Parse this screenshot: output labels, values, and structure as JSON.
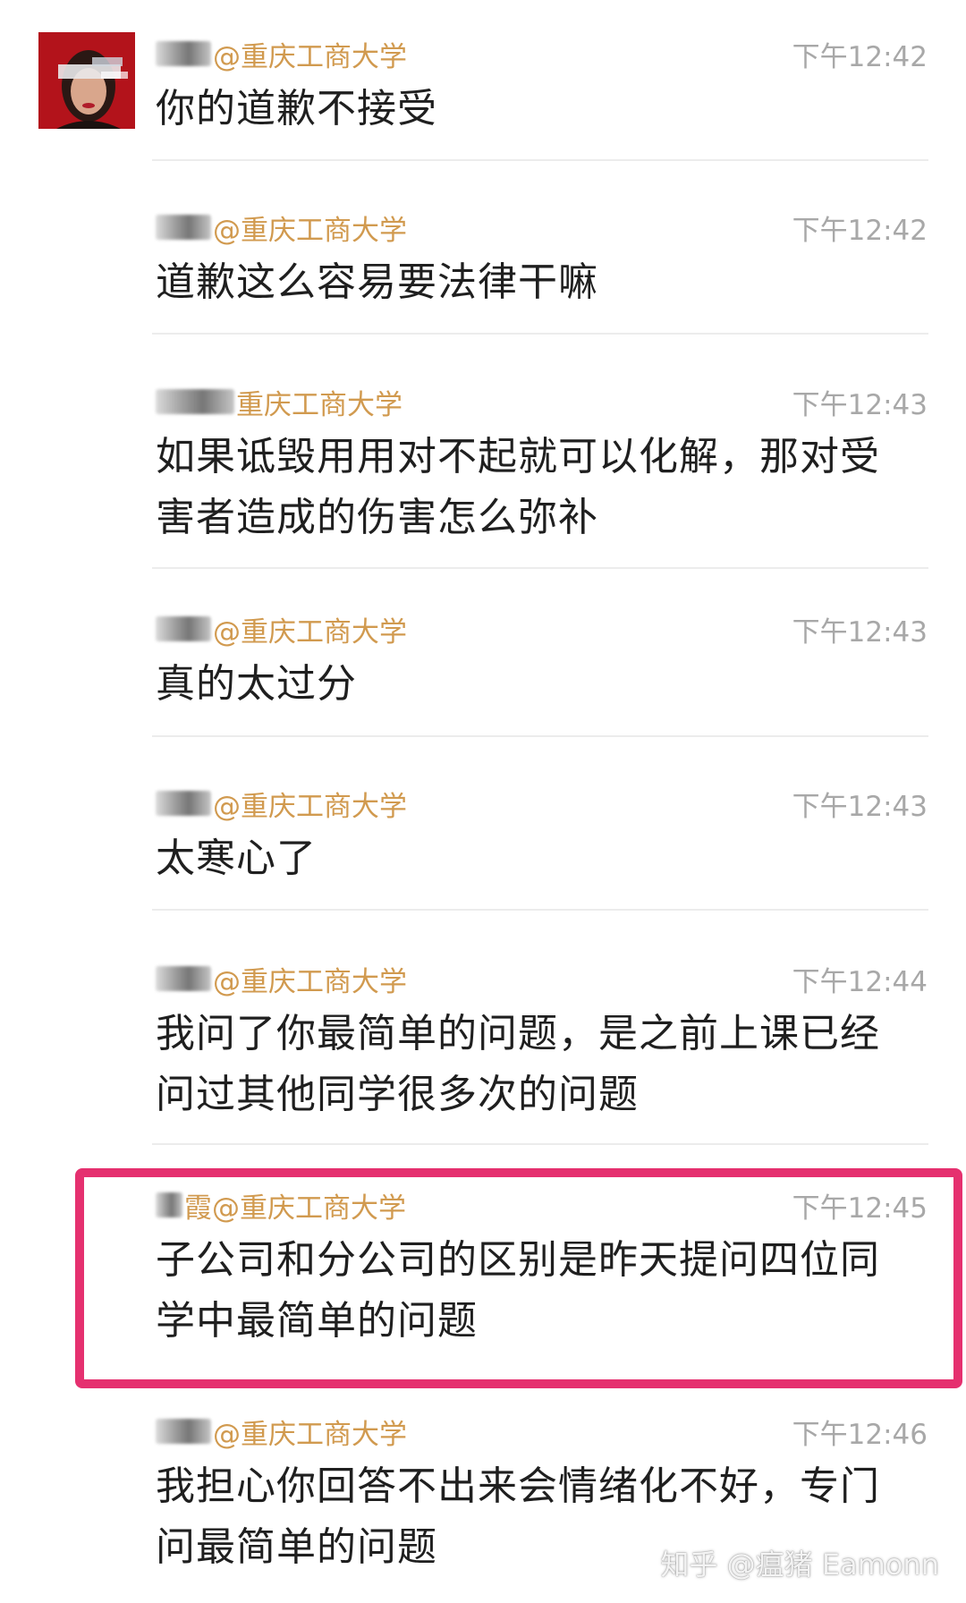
{
  "colors": {
    "sender_name": "#d19a4f",
    "time": "#a8a8a8",
    "message_text": "#1f1f1f",
    "highlight_border": "#e5306f",
    "divider": "#ececec"
  },
  "messages": [
    {
      "sender": "@重庆工商大学",
      "time": "下午12:42",
      "text": "你的道歉不接受"
    },
    {
      "sender": "@重庆工商大学",
      "time": "下午12:42",
      "text": "道歉这么容易要法律干嘛"
    },
    {
      "sender": "重庆工商大学",
      "time": "下午12:43",
      "text": "如果诋毁用用对不起就可以化解，那对受害者造成的伤害怎么弥补"
    },
    {
      "sender": "@重庆工商大学",
      "time": "下午12:43",
      "text": "真的太过分"
    },
    {
      "sender": "@重庆工商大学",
      "time": "下午12:43",
      "text": "太寒心了"
    },
    {
      "sender": "@重庆工商大学",
      "time": "下午12:44",
      "text": "我问了你最简单的问题，是之前上课已经问过其他同学很多次的问题"
    },
    {
      "sender": "霞@重庆工商大学",
      "time": "下午12:45",
      "text": "子公司和分公司的区别是昨天提问四位同学中最简单的问题"
    },
    {
      "sender": "@重庆工商大学",
      "time": "下午12:46",
      "text": "我担心你回答不出来会情绪化不好，专门问最简单的问题"
    }
  ],
  "watermark": "知乎 @瘟猪 Eamonn",
  "avatar_icon": "portrait-avatar-icon"
}
